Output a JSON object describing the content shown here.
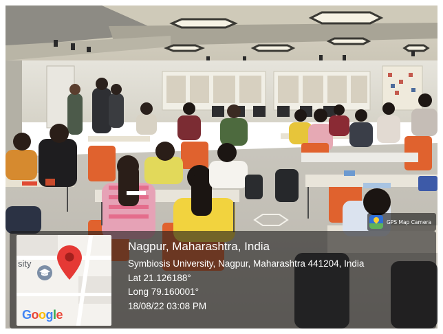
{
  "watermark": {
    "app_label": "GPS Map Camera",
    "app_icon": "gps-map-camera-icon"
  },
  "location": {
    "place": "Nagpur, Maharashtra, India",
    "address": "Symbiosis University, Nagpur, Maharashtra 441204, India",
    "latitude": "Lat 21.126188°",
    "longitude": "Long 79.160001°",
    "timestamp": "18/08/22 03:08 PM"
  },
  "map": {
    "partial_label": "sity",
    "provider_logo": "Google",
    "pin_color": "#e53935",
    "poi_icon": "graduation-cap-icon"
  }
}
